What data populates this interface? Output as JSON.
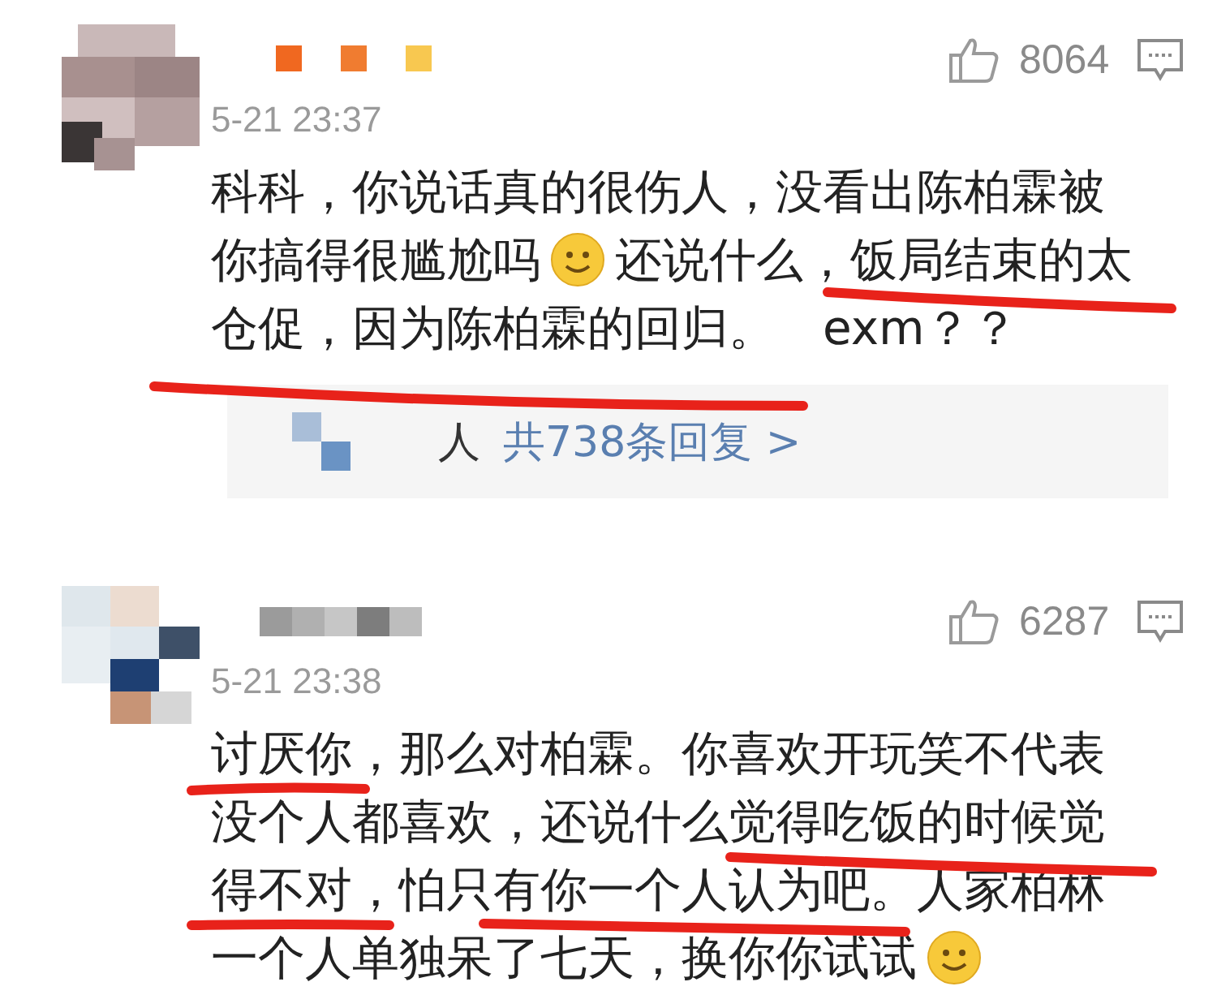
{
  "comments": [
    {
      "likes": "8064",
      "time": "5-21 23:37",
      "lines": [
        [
          {
            "kind": "text",
            "text": "科科，你说话真的很伤人，没看出陈柏霖被"
          }
        ],
        [
          {
            "kind": "text",
            "text": "你搞得很尴尬吗"
          },
          {
            "kind": "emoji"
          },
          {
            "kind": "text",
            "text": "还说什么，饭局结束的太"
          }
        ],
        [
          {
            "kind": "text",
            "text": "仓促，因为陈柏霖的回归。　exm？？"
          }
        ]
      ],
      "replies": {
        "names": "人",
        "link": "共738条回复 >"
      }
    },
    {
      "likes": "6287",
      "time": "5-21 23:38",
      "lines": [
        [
          {
            "kind": "text",
            "text": "讨厌你，那么对柏霖。你喜欢开玩笑不代表"
          }
        ],
        [
          {
            "kind": "text",
            "text": "没个人都喜欢，还说什么觉得吃饭的时候觉"
          }
        ],
        [
          {
            "kind": "text",
            "text": "得不对，怕只有你一个人认为吧。人家柏林"
          }
        ],
        [
          {
            "kind": "text",
            "text": "一个人单独呆了七天，换你你试试"
          },
          {
            "kind": "emoji"
          }
        ]
      ]
    }
  ]
}
